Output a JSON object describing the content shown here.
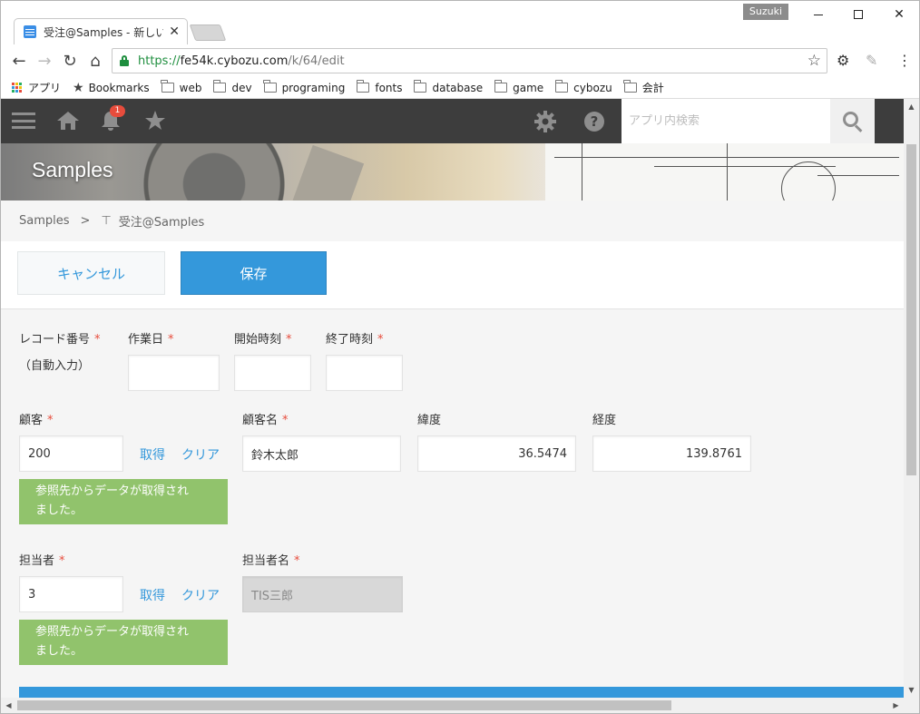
{
  "browser": {
    "tab_title": "受注@Samples - 新しいレ",
    "user_badge": "Suzuki",
    "url_scheme": "https://",
    "url_host": "fe54k.cybozu.com",
    "url_path": "/k/64/edit",
    "bookmarks": [
      {
        "label": "アプリ",
        "icon": "apps-icon"
      },
      {
        "label": "Bookmarks",
        "icon": "star-icon"
      },
      {
        "label": "web",
        "icon": "folder-icon"
      },
      {
        "label": "dev",
        "icon": "folder-icon"
      },
      {
        "label": "programing",
        "icon": "folder-icon"
      },
      {
        "label": "fonts",
        "icon": "folder-icon"
      },
      {
        "label": "database",
        "icon": "folder-icon"
      },
      {
        "label": "game",
        "icon": "folder-icon"
      },
      {
        "label": "cybozu",
        "icon": "folder-icon"
      },
      {
        "label": "会計",
        "icon": "folder-icon"
      }
    ]
  },
  "kintone": {
    "notification_count": "1",
    "search_placeholder": "アプリ内検索",
    "app_space_title": "Samples",
    "breadcrumb": {
      "root": "Samples",
      "separator": ">",
      "app": "受注@Samples"
    },
    "buttons": {
      "cancel": "キャンセル",
      "save": "保存"
    },
    "colors": {
      "accent": "#3498db",
      "header": "#3d3d3d",
      "notice": "#91c36c",
      "required": "#e74c3c"
    }
  },
  "form": {
    "required_mark": "*",
    "record_number": {
      "label": "レコード番号",
      "value": "（自動入力）"
    },
    "work_date": {
      "label": "作業日",
      "value": ""
    },
    "start_time": {
      "label": "開始時刻",
      "value": ""
    },
    "end_time": {
      "label": "終了時刻",
      "value": ""
    },
    "customer": {
      "label": "顧客",
      "value": "200",
      "fetch": "取得",
      "clear": "クリア",
      "notice": "参照先からデータが取得されました。",
      "notice_line1": "参照先からデータが取得され",
      "notice_line2": "ました。"
    },
    "customer_name": {
      "label": "顧客名",
      "value": "鈴木太郎"
    },
    "latitude": {
      "label": "緯度",
      "value": "36.5474"
    },
    "longitude": {
      "label": "経度",
      "value": "139.8761"
    },
    "staff": {
      "label": "担当者",
      "value": "3",
      "fetch": "取得",
      "clear": "クリア",
      "notice_line1": "参照先からデータが取得され",
      "notice_line2": "ました。"
    },
    "staff_name": {
      "label": "担当者名",
      "value": "TIS三郎"
    }
  }
}
